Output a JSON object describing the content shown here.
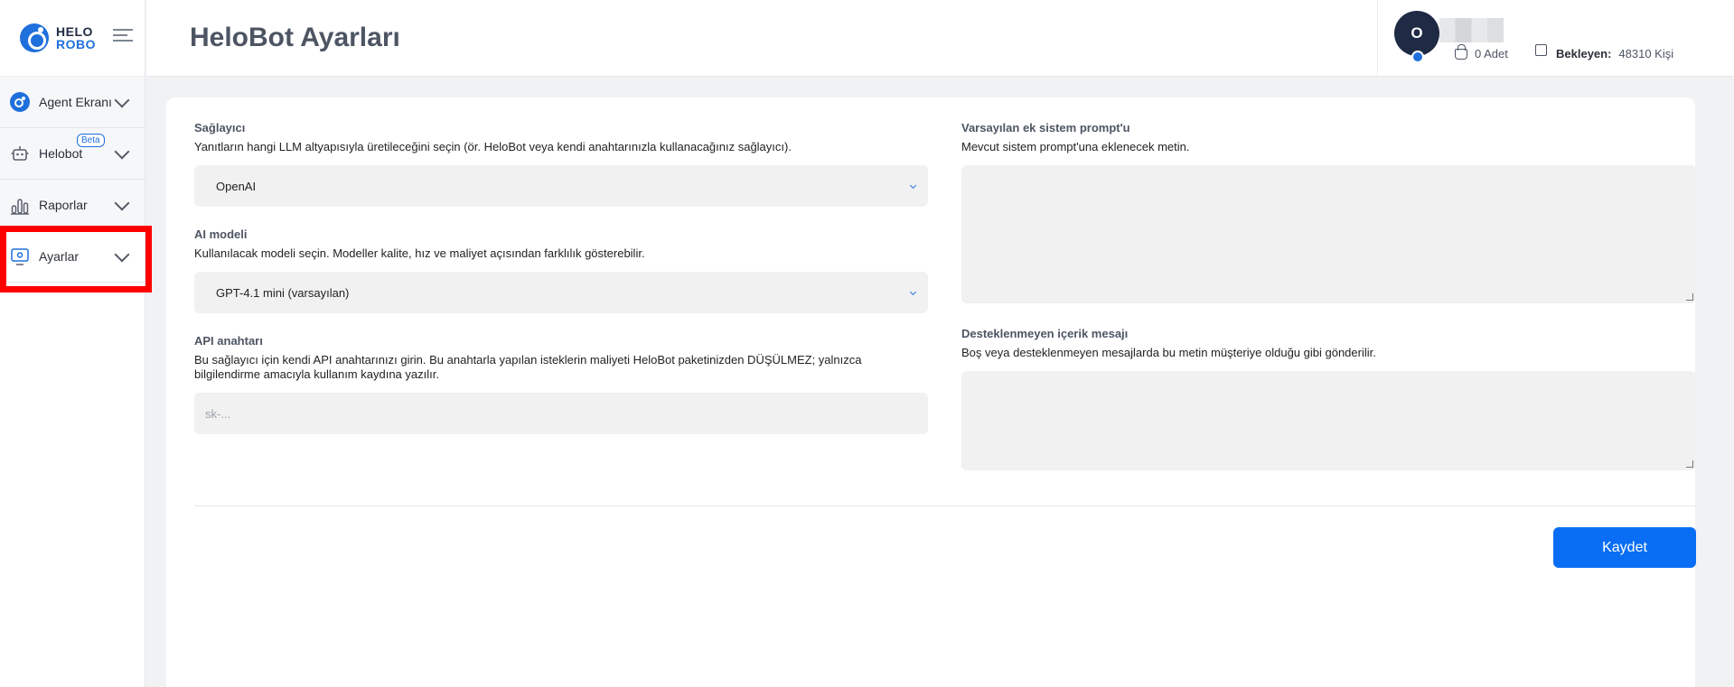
{
  "brand": {
    "line1": "HELO",
    "line2": "ROBO"
  },
  "sidebar": {
    "items": [
      {
        "label": "Agent Ekranı",
        "icon": "agent-icon"
      },
      {
        "label": "Helobot",
        "badge": "Beta",
        "icon": "robot-icon"
      },
      {
        "label": "Raporlar",
        "icon": "chart-icon"
      },
      {
        "label": "Ayarlar",
        "icon": "settings-icon"
      }
    ]
  },
  "header": {
    "title": "HeloBot Ayarları",
    "avatar_initial": "O",
    "basket_text": "0 Adet",
    "waiting_label": "Bekleyen:",
    "waiting_value": "48310 Kişi"
  },
  "form": {
    "provider": {
      "label": "Sağlayıcı",
      "help": "Yanıtların hangi LLM altyapısıyla üretileceğini seçin (ör. HeloBot veya kendi anahtarınızla kullanacağınız sağlayıcı).",
      "value": "OpenAI"
    },
    "model": {
      "label": "AI modeli",
      "help": "Kullanılacak modeli seçin. Modeller kalite, hız ve maliyet açısından farklılık gösterebilir.",
      "value": "GPT-4.1 mini (varsayılan)"
    },
    "api_key": {
      "label": "API anahtarı",
      "help": "Bu sağlayıcı için kendi API anahtarınızı girin. Bu anahtarla yapılan isteklerin maliyeti HeloBot paketinizden DÜŞÜLMEZ; yalnızca bilgilendirme amacıyla kullanım kaydına yazılır.",
      "placeholder": "sk-..."
    },
    "system_prompt": {
      "label": "Varsayılan ek sistem prompt'u",
      "help": "Mevcut sistem prompt'una eklenecek metin."
    },
    "unsupported": {
      "label": "Desteklenmeyen içerik mesajı",
      "help": "Boş veya desteklenmeyen mesajlarda bu metin müşteriye olduğu gibi gönderilir."
    },
    "save_label": "Kaydet"
  }
}
